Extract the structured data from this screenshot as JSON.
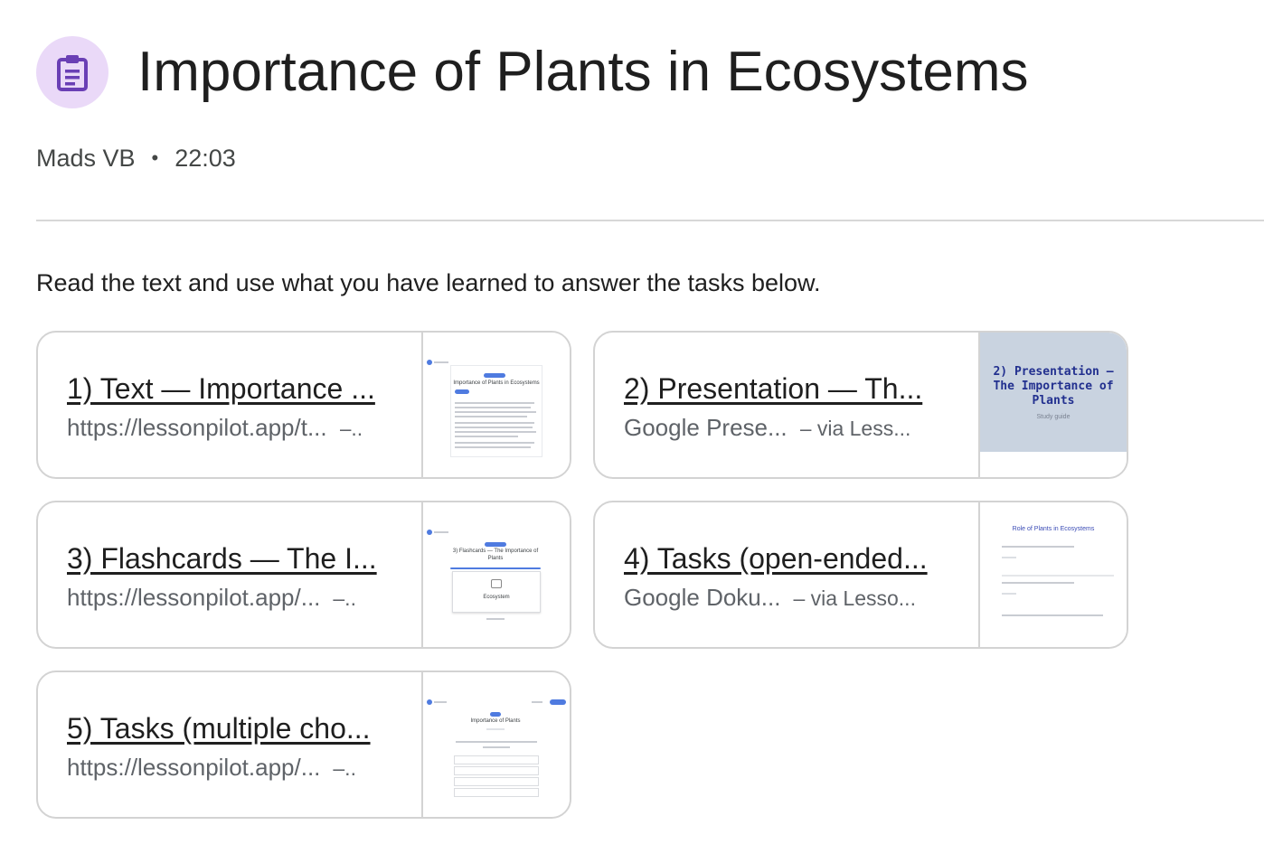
{
  "header": {
    "icon": "assignment-icon",
    "title": "Importance of Plants in Ecosystems",
    "author": "Mads VB",
    "separator": "•",
    "time": "22:03"
  },
  "instructions": "Read the text and use what you have learned to answer the tasks below.",
  "attachments": [
    {
      "title": "1) Text — Importance ...",
      "source": "https://lessonpilot.app/t...",
      "via": "–..",
      "thumb": {
        "type": "webpage",
        "heading": "Importance of Plants in Ecosystems"
      }
    },
    {
      "title": "2) Presentation — Th...",
      "source": "Google Prese...",
      "via": "– via Less...",
      "thumb": {
        "type": "slide",
        "heading": "2) Presentation — The Importance of Plants",
        "subheading": "Study guide"
      }
    },
    {
      "title": "3) Flashcards — The I...",
      "source": "https://lessonpilot.app/...",
      "via": "–..",
      "thumb": {
        "type": "flashcards",
        "heading": "3) Flashcards — The Importance of Plants",
        "card_text": "Ecosystem"
      }
    },
    {
      "title": "4) Tasks (open-ended...",
      "source": "Google Doku...",
      "via": "– via Lesso...",
      "thumb": {
        "type": "document",
        "heading": "Role of Plants in Ecosystems"
      }
    },
    {
      "title": "5) Tasks (multiple cho...",
      "source": "https://lessonpilot.app/...",
      "via": "–..",
      "thumb": {
        "type": "quiz",
        "heading": "Importance of Plants"
      }
    }
  ],
  "colors": {
    "icon_bg": "#ead9f8",
    "icon_fg": "#6a3fb5",
    "card_border": "#d3d3d3",
    "slide_bg": "#c9d3e0",
    "slide_text": "#22308f"
  }
}
